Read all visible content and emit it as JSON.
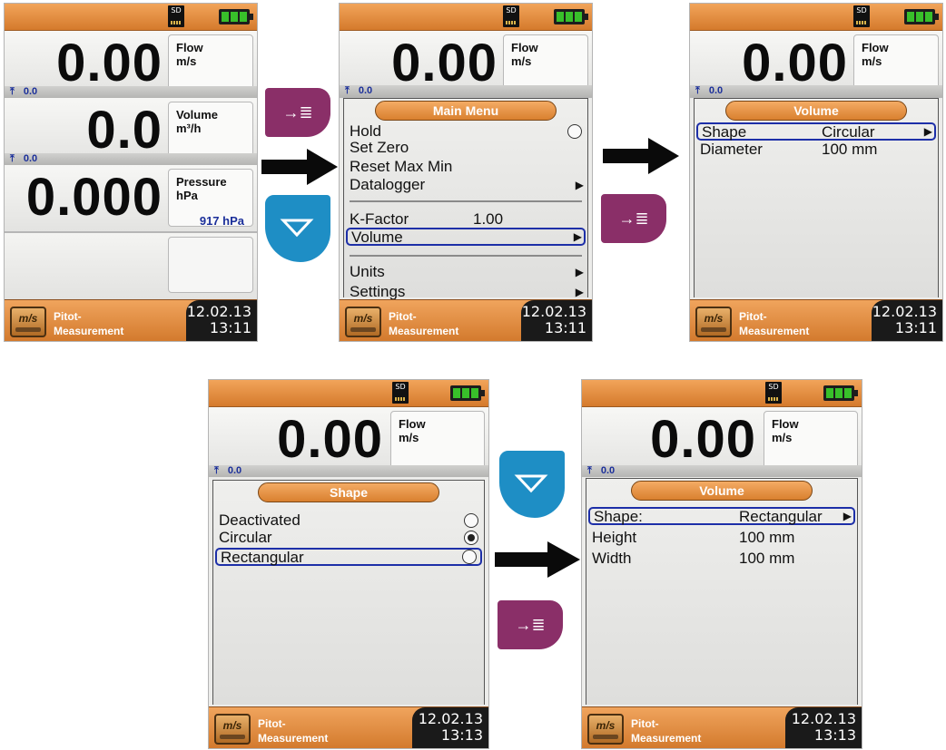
{
  "status": {
    "sd_label": "SD"
  },
  "screen1": {
    "flow": {
      "value": "0.00",
      "label": "Flow",
      "unit": "m/s",
      "max": "0.0"
    },
    "volume": {
      "value": "0.0",
      "label": "Volume",
      "unit": "m³/h",
      "max": "0.0"
    },
    "pressure": {
      "value": "0.000",
      "label": "Pressure",
      "unit": "hPa",
      "atm": "917 hPa"
    },
    "mode": {
      "line1": "Pitot-",
      "line2": "Measurement"
    },
    "date": "12.02.13",
    "time": "13:11"
  },
  "screen2": {
    "flow": {
      "value": "0.00",
      "label": "Flow",
      "unit": "m/s",
      "max": "0.0"
    },
    "menu_title": "Main Menu",
    "items": [
      {
        "label": "Hold"
      },
      {
        "label": "Set Zero"
      },
      {
        "label": "Reset Max Min"
      },
      {
        "label": "Datalogger"
      },
      {
        "label": "K-Factor",
        "value": "1.00"
      },
      {
        "label": "Volume"
      },
      {
        "label": "Units"
      },
      {
        "label": "Settings"
      }
    ],
    "mode": {
      "line1": "Pitot-",
      "line2": "Measurement"
    },
    "date": "12.02.13",
    "time": "13:11"
  },
  "screen3": {
    "flow": {
      "value": "0.00",
      "label": "Flow",
      "unit": "m/s",
      "max": "0.0"
    },
    "menu_title": "Volume",
    "items": [
      {
        "label": "Shape",
        "value": "Circular"
      },
      {
        "label": "Diameter",
        "value": "100 mm"
      }
    ],
    "mode": {
      "line1": "Pitot-",
      "line2": "Measurement"
    },
    "date": "12.02.13",
    "time": "13:11"
  },
  "screen4": {
    "flow": {
      "value": "0.00",
      "label": "Flow",
      "unit": "m/s",
      "max": "0.0"
    },
    "menu_title": "Shape",
    "items": [
      {
        "label": "Deactivated"
      },
      {
        "label": "Circular"
      },
      {
        "label": "Rectangular"
      }
    ],
    "mode": {
      "line1": "Pitot-",
      "line2": "Measurement"
    },
    "date": "12.02.13",
    "time": "13:13"
  },
  "screen5": {
    "flow": {
      "value": "0.00",
      "label": "Flow",
      "unit": "m/s",
      "max": "0.0"
    },
    "menu_title": "Volume",
    "items": [
      {
        "label": "Shape:",
        "value": "Rectangular"
      },
      {
        "label": "Height",
        "value": "100 mm"
      },
      {
        "label": "Width",
        "value": "100 mm"
      }
    ],
    "mode": {
      "line1": "Pitot-",
      "line2": "Measurement"
    },
    "date": "12.02.13",
    "time": "13:13"
  },
  "colors": {
    "accent_orange": "#e08a3c",
    "selection_blue": "#1d2fa8",
    "enter_key": "#8a2f68",
    "down_key": "#1e8ec5",
    "battery_green": "#38c02a"
  },
  "icons": {
    "enter_key": "enter-key-icon",
    "down_key": "down-key-icon",
    "arrow": "arrow-right-icon",
    "max": "max-arrow-icon",
    "mode": "pitot-measurement-icon"
  }
}
